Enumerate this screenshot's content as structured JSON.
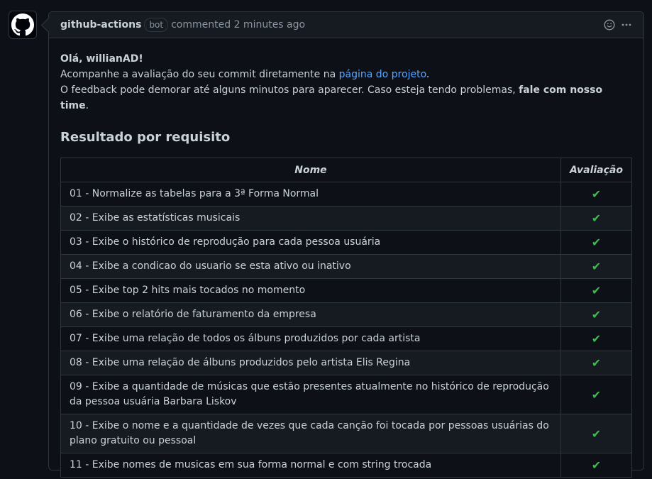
{
  "comment": {
    "author": "github-actions",
    "badge": "bot",
    "meta": "commented 2 minutes ago",
    "greeting": "Olá, willianAD!",
    "line2_prefix": "Acompanhe a avaliação do seu commit diretamente na ",
    "line2_link": "página do projeto",
    "line2_suffix": ".",
    "line3_prefix": "O feedback pode demorar até alguns minutos para aparecer. Caso esteja tendo problemas, ",
    "line3_bold": "fale com nosso time",
    "line3_suffix": ".",
    "section_title": "Resultado por requisito"
  },
  "table": {
    "headers": [
      "Nome",
      "Avaliação"
    ],
    "rows": [
      {
        "name": "01 - Normalize as tabelas para a 3ª Forma Normal",
        "result": "✔"
      },
      {
        "name": "02 - Exibe as estatísticas musicais",
        "result": "✔"
      },
      {
        "name": "03 - Exibe o histórico de reprodução para cada pessoa usuária",
        "result": "✔"
      },
      {
        "name": "04 - Exibe a condicao do usuario se esta ativo ou inativo",
        "result": "✔"
      },
      {
        "name": "05 - Exibe top 2 hits mais tocados no momento",
        "result": "✔"
      },
      {
        "name": "06 - Exibe o relatório de faturamento da empresa",
        "result": "✔"
      },
      {
        "name": "07 - Exibe uma relação de todos os álbuns produzidos por cada artista",
        "result": "✔"
      },
      {
        "name": "08 - Exibe uma relação de álbuns produzidos pelo artista Elis Regina",
        "result": "✔"
      },
      {
        "name": "09 - Exibe a quantidade de músicas que estão presentes atualmente no histórico de reprodução da pessoa usuária Barbara Liskov",
        "result": "✔"
      },
      {
        "name": "10 - Exibe o nome e a quantidade de vezes que cada canção foi tocada por pessoas usuárias do plano gratuito ou pessoal",
        "result": "✔"
      },
      {
        "name": "11 - Exibe nomes de musicas em sua forma normal e com string trocada",
        "result": "✔"
      }
    ]
  },
  "icons": {
    "avatar": "github-logo-icon",
    "reaction": "smiley-icon",
    "more": "kebab-horizontal-icon"
  },
  "colors": {
    "background": "#0d1117",
    "link": "#58a6ff",
    "check": "#3fb950",
    "border": "#30363d"
  }
}
